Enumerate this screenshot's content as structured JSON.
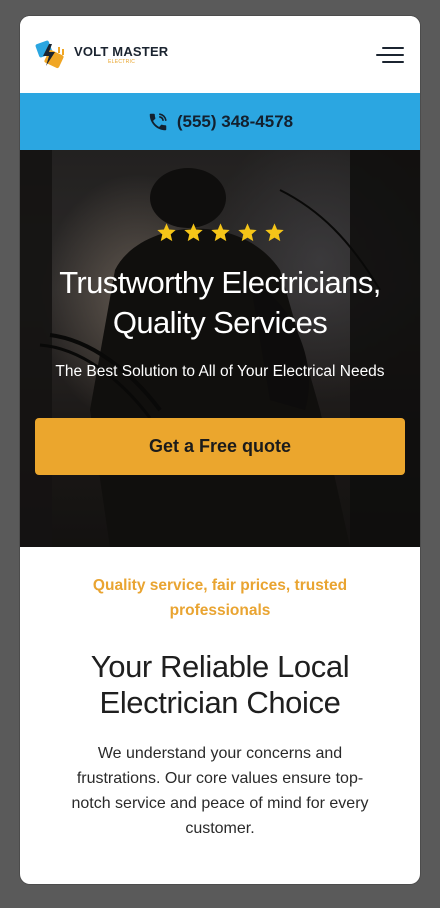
{
  "brand": {
    "name": "VOLT MASTER",
    "tagline": "ELECTRIC",
    "logo_icon": "lightning-plug-icon",
    "accent": "#e8a42a"
  },
  "nav": {
    "menu_icon": "hamburger-menu-icon"
  },
  "phone_bar": {
    "number": "(555) 348-4578",
    "icon": "phone-ringing-icon",
    "color": "#2ba6e1"
  },
  "hero": {
    "rating": 5,
    "title_line1": "Trustworthy Electricians,",
    "title_line2": "Quality Services",
    "subtitle": "The Best Solution to All of Your Electrical Needs",
    "cta_label": "Get a Free quote",
    "cta_color": "#eba62d"
  },
  "intro": {
    "eyebrow": "Quality service, fair prices, trusted professionals",
    "title_line1": "Your Reliable Local",
    "title_line2": "Electrician Choice",
    "body": "We understand your concerns and frustrations. Our core values ensure top-notch service and peace of mind for every customer."
  }
}
